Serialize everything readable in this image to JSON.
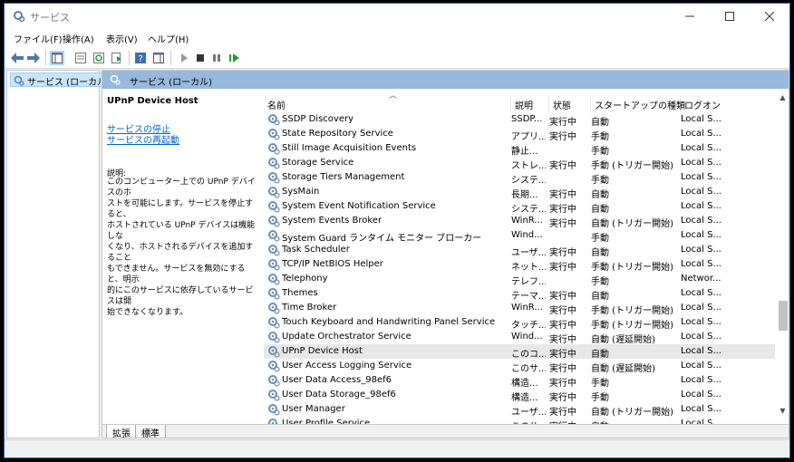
{
  "window": {
    "title": "サービス"
  },
  "menu": [
    "ファイル(F)",
    "操作(A)",
    "表示(V)",
    "ヘルプ(H)"
  ],
  "tree": {
    "item": "サービス (ローカル)"
  },
  "main": {
    "header": "サービス (ローカル)"
  },
  "details": {
    "title": "UPnP Device Host",
    "link_stop": "サービスの停止",
    "link_restart": "サービスの再起動",
    "desc_label": "説明:",
    "desc_lines": [
      "このコンピューター上での UPnP デバイスのホ",
      "ストを可能にします。サービスを停止すると、",
      "ホストされている UPnP デバイスは機能しな",
      "くなり、ホストされるデバイスを追加すること",
      "もできません。サービスを無効にすると、明示",
      "的にこのサービスに依存しているサービスは開",
      "始できなくなります。"
    ]
  },
  "columns": {
    "name": "名前",
    "desc": "説明",
    "state": "状態",
    "start": "スタートアップの種類",
    "logon": "ログオン"
  },
  "services": [
    {
      "name": "SSDP Discovery",
      "desc": "SSDP...",
      "state": "実行中",
      "start": "自動",
      "logon": "Local S..."
    },
    {
      "name": "State Repository Service",
      "desc": "アプリ...",
      "state": "実行中",
      "start": "手動",
      "logon": "Local S..."
    },
    {
      "name": "Still Image Acquisition Events",
      "desc": "静止...",
      "state": "",
      "start": "手動",
      "logon": "Local S..."
    },
    {
      "name": "Storage Service",
      "desc": "ストレ...",
      "state": "実行中",
      "start": "手動 (トリガー開始)",
      "logon": "Local S..."
    },
    {
      "name": "Storage Tiers Management",
      "desc": "システ...",
      "state": "",
      "start": "手動",
      "logon": "Local S..."
    },
    {
      "name": "SysMain",
      "desc": "長期...",
      "state": "実行中",
      "start": "自動",
      "logon": "Local S..."
    },
    {
      "name": "System Event Notification Service",
      "desc": "システ...",
      "state": "実行中",
      "start": "自動",
      "logon": "Local S..."
    },
    {
      "name": "System Events Broker",
      "desc": "WinR...",
      "state": "実行中",
      "start": "自動 (トリガー開始)",
      "logon": "Local S..."
    },
    {
      "name": "System Guard ランタイム モニター ブローカー",
      "desc": "Wind...",
      "state": "",
      "start": "手動",
      "logon": "Local S..."
    },
    {
      "name": "Task Scheduler",
      "desc": "ユーザ...",
      "state": "実行中",
      "start": "自動",
      "logon": "Local S..."
    },
    {
      "name": "TCP/IP NetBIOS Helper",
      "desc": "ネット...",
      "state": "実行中",
      "start": "手動 (トリガー開始)",
      "logon": "Local S..."
    },
    {
      "name": "Telephony",
      "desc": "テレフ...",
      "state": "",
      "start": "手動",
      "logon": "Networ..."
    },
    {
      "name": "Themes",
      "desc": "テーマ...",
      "state": "実行中",
      "start": "自動",
      "logon": "Local S..."
    },
    {
      "name": "Time Broker",
      "desc": "WinR...",
      "state": "実行中",
      "start": "手動 (トリガー開始)",
      "logon": "Local S..."
    },
    {
      "name": "Touch Keyboard and Handwriting Panel Service",
      "desc": "タッチ...",
      "state": "実行中",
      "start": "手動 (トリガー開始)",
      "logon": "Local S..."
    },
    {
      "name": "Update Orchestrator Service",
      "desc": "Wind...",
      "state": "実行中",
      "start": "自動 (遅延開始)",
      "logon": "Local S..."
    },
    {
      "name": "UPnP Device Host",
      "desc": "このコ...",
      "state": "実行中",
      "start": "自動",
      "logon": "Local S...",
      "selected": true
    },
    {
      "name": "User Access Logging Service",
      "desc": "このサ...",
      "state": "実行中",
      "start": "自動 (遅延開始)",
      "logon": "Local S..."
    },
    {
      "name": "User Data Access_98ef6",
      "desc": "構造...",
      "state": "実行中",
      "start": "手動",
      "logon": "Local S..."
    },
    {
      "name": "User Data Storage_98ef6",
      "desc": "構造...",
      "state": "実行中",
      "start": "手動",
      "logon": "Local S..."
    },
    {
      "name": "User Manager",
      "desc": "ユーザ...",
      "state": "実行中",
      "start": "自動 (トリガー開始)",
      "logon": "Local S..."
    },
    {
      "name": "User Profile Service",
      "desc": "このサ...",
      "state": "実行中",
      "start": "自動",
      "logon": "Local S..."
    }
  ],
  "tabs": [
    "拡張",
    "標準"
  ],
  "colors": {
    "header_bg": "#97b9dd",
    "selected_bg": "#cce4f7",
    "link": "#0066cc"
  }
}
